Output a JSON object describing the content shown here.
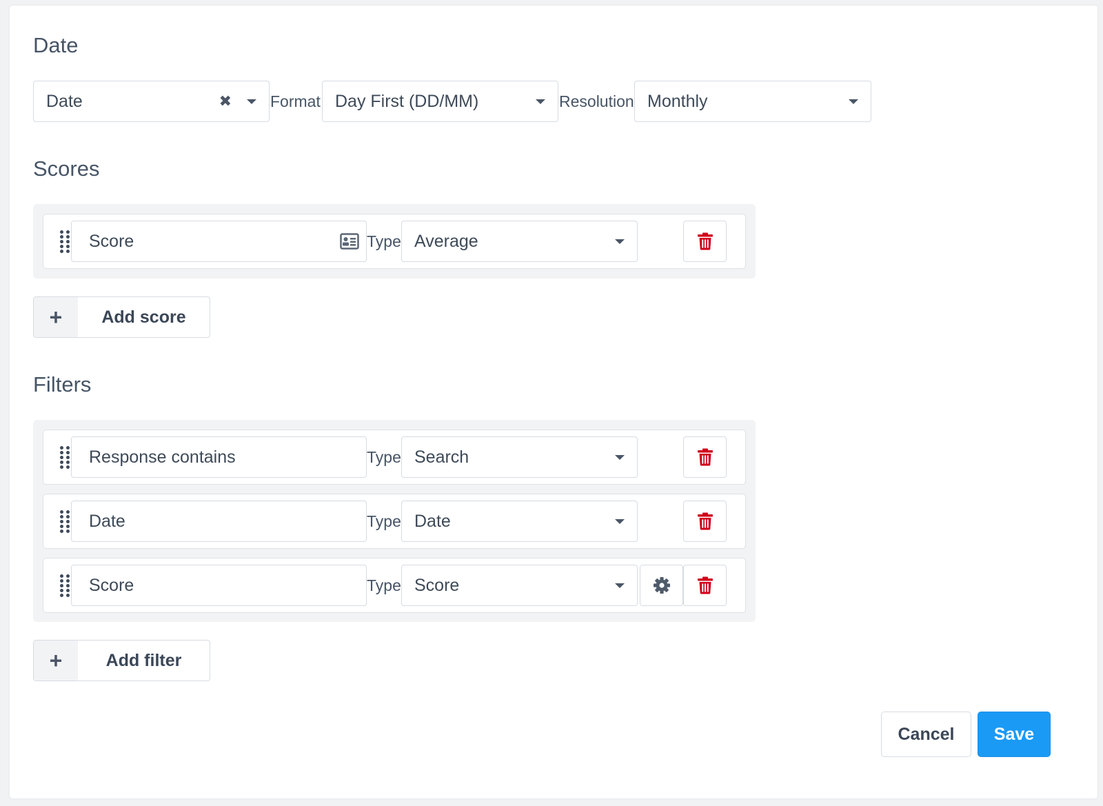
{
  "date_section": {
    "title": "Date",
    "field_value": "Date",
    "format_label": "Format",
    "format_value": "Day First (DD/MM)",
    "resolution_label": "Resolution",
    "resolution_value": "Monthly"
  },
  "scores_section": {
    "title": "Scores",
    "rows": [
      {
        "name": "Score",
        "type_label": "Type",
        "type_value": "Average",
        "icons": [
          "card-icon",
          "trash-icon"
        ]
      }
    ],
    "add_label": "Add score"
  },
  "filters_section": {
    "title": "Filters",
    "rows": [
      {
        "name": "Response contains",
        "type_label": "Type",
        "type_value": "Search",
        "icons": [
          "trash-icon"
        ]
      },
      {
        "name": "Date",
        "type_label": "Type",
        "type_value": "Date",
        "icons": [
          "trash-icon"
        ]
      },
      {
        "name": "Score",
        "type_label": "Type",
        "type_value": "Score",
        "icons": [
          "gear-icon",
          "trash-icon"
        ]
      }
    ],
    "add_label": "Add filter"
  },
  "footer": {
    "cancel_label": "Cancel",
    "save_label": "Save"
  },
  "colors": {
    "primary": "#1a9af5",
    "danger": "#d0021b",
    "text": "#3e4a58",
    "border": "#d6dbe1",
    "group_bg": "#f2f3f5"
  }
}
